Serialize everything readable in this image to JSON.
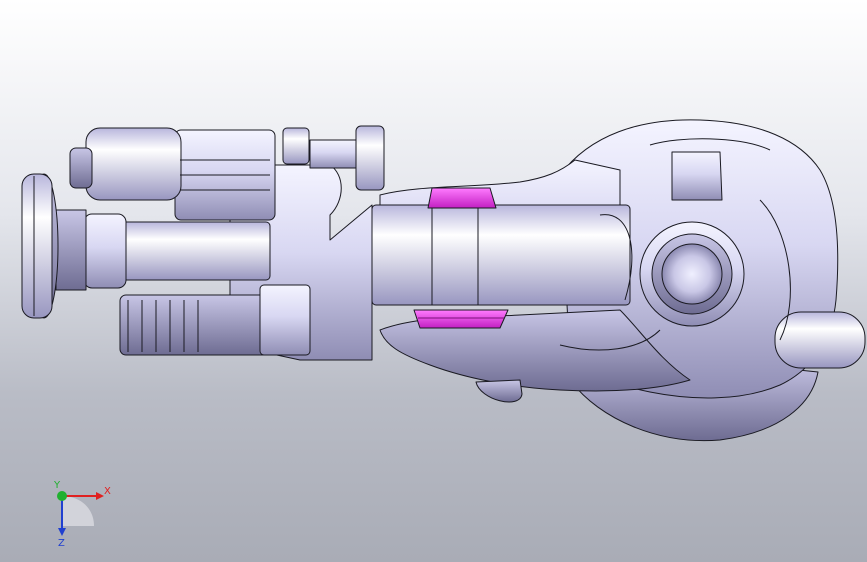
{
  "triad": {
    "x_label": "X",
    "y_label": "Y",
    "z_label": "Z",
    "x_color": "#e02020",
    "y_color": "#20b030",
    "z_color": "#2040d0"
  },
  "model": {
    "body_color": "#d9d8f2",
    "shade_color": "#9c9ac0",
    "edge_color": "#1a1a22",
    "highlight_color": "#e63ce6"
  }
}
